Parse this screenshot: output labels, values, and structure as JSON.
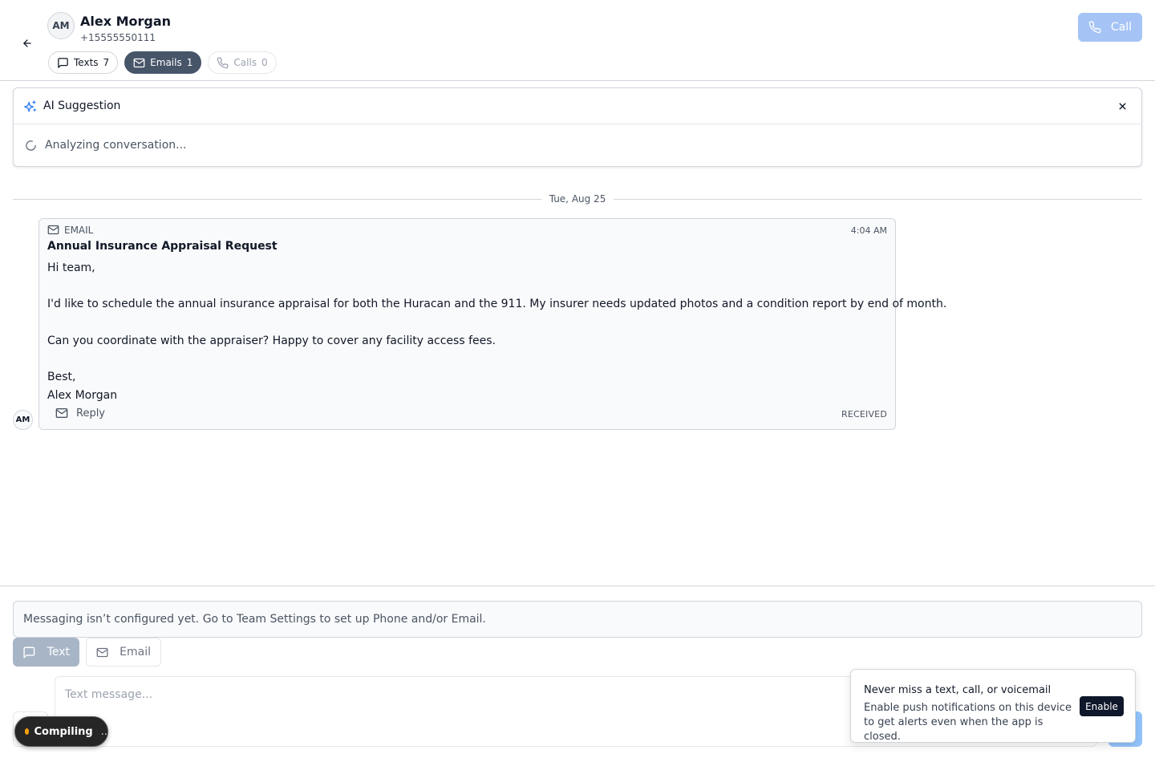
{
  "contact": {
    "initials": "AM",
    "name": "Alex Morgan",
    "phone": "+15555550111"
  },
  "tabs": [
    {
      "label": "Texts",
      "count": "7",
      "icon": "message-square-icon",
      "state": "default"
    },
    {
      "label": "Emails",
      "count": "1",
      "icon": "mail-icon",
      "state": "active"
    },
    {
      "label": "Calls",
      "count": "0",
      "icon": "phone-icon",
      "state": "disabled"
    }
  ],
  "header": {
    "call_label": "Call"
  },
  "ai_suggestion": {
    "title": "AI Suggestion",
    "status": "Analyzing conversation..."
  },
  "thread": {
    "date_label": "Tue, Aug 25",
    "email": {
      "type_label": "EMAIL",
      "time": "4:04 AM",
      "subject": "Annual Insurance Appraisal Request",
      "body_lines": [
        "Hi team,",
        "",
        "I'd like to schedule the annual insurance appraisal for both the Huracan and the 911. My insurer needs updated photos and a condition report by end of month.",
        "",
        "Can you coordinate with the appraiser? Happy to cover any facility access fees.",
        "",
        "Best,",
        "Alex Morgan"
      ],
      "reply_label": "Reply",
      "direction": "RECEIVED",
      "sender_initials": "AM"
    }
  },
  "composer": {
    "notice": "Messaging isn’t configured yet. Go to Team Settings to set up Phone and/or Email.",
    "modes": [
      {
        "label": "Text",
        "icon": "message-square-icon"
      },
      {
        "label": "Email",
        "icon": "mail-icon"
      }
    ],
    "placeholder": "Text message..."
  },
  "push_popup": {
    "title": "Never miss a text, call, or voicemail",
    "description": "Enable push notifications on this device to get alerts even when the app is closed.",
    "enable_label": "Enable"
  },
  "status_pill": {
    "label": "Compiling",
    "dots": ".."
  }
}
